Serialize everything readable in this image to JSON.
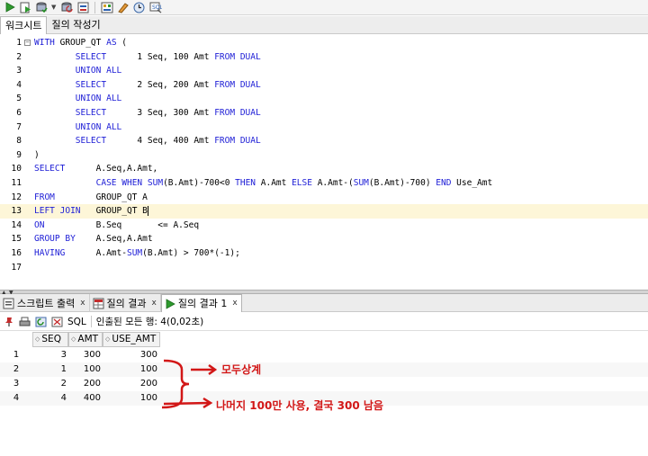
{
  "toolbar": {
    "buttons": [
      "run-statement-icon",
      "run-script-icon",
      "commit-icon",
      "rollback-icon",
      "autotrace-icon",
      "explain-plan-icon",
      "sql-tuning-icon",
      "clear-icon",
      "history-icon",
      "sql-monitor-icon"
    ]
  },
  "tabs": [
    {
      "label": "워크시트",
      "active": true
    },
    {
      "label": "질의 작성기",
      "active": false
    }
  ],
  "editor": {
    "current_line": 13,
    "lines": [
      {
        "n": "1",
        "text": "WITH GROUP_QT AS ("
      },
      {
        "n": "2",
        "text": "        SELECT      1 Seq, 100 Amt FROM DUAL"
      },
      {
        "n": "3",
        "text": "        UNION ALL"
      },
      {
        "n": "4",
        "text": "        SELECT      2 Seq, 200 Amt FROM DUAL"
      },
      {
        "n": "5",
        "text": "        UNION ALL"
      },
      {
        "n": "6",
        "text": "        SELECT      3 Seq, 300 Amt FROM DUAL"
      },
      {
        "n": "7",
        "text": "        UNION ALL"
      },
      {
        "n": "8",
        "text": "        SELECT      4 Seq, 400 Amt FROM DUAL"
      },
      {
        "n": "9",
        "text": ")"
      },
      {
        "n": "10",
        "text": "SELECT      A.Seq,A.Amt,"
      },
      {
        "n": "11",
        "text": "            CASE WHEN SUM(B.Amt)-700<0 THEN A.Amt ELSE A.Amt-(SUM(B.Amt)-700) END Use_Amt"
      },
      {
        "n": "12",
        "text": "FROM        GROUP_QT A"
      },
      {
        "n": "13",
        "text": "LEFT JOIN   GROUP_QT B"
      },
      {
        "n": "14",
        "text": "ON          B.Seq       <= A.Seq"
      },
      {
        "n": "15",
        "text": "GROUP BY    A.Seq,A.Amt"
      },
      {
        "n": "16",
        "text": "HAVING      A.Amt-SUM(B.Amt) > 700*(-1);"
      },
      {
        "n": "17",
        "text": ""
      }
    ]
  },
  "bottom_tabs": [
    {
      "label": "스크립트 출력",
      "icon": "script-output-icon",
      "close": "x",
      "active": false
    },
    {
      "label": "질의 결과",
      "icon": "query-result-icon",
      "close": "x",
      "active": false
    },
    {
      "label": "질의 결과 1",
      "icon": "run-result-icon",
      "close": "x",
      "active": true
    }
  ],
  "result_toolbar": {
    "sql_label": "SQL",
    "status": "인출된 모든 행: 4(0,02초)"
  },
  "grid": {
    "columns": [
      "SEQ",
      "AMT",
      "USE_AMT"
    ],
    "rows": [
      {
        "rownum": "1",
        "seq": "3",
        "amt": "300",
        "use_amt": "300"
      },
      {
        "rownum": "2",
        "seq": "1",
        "amt": "100",
        "use_amt": "100"
      },
      {
        "rownum": "3",
        "seq": "2",
        "amt": "200",
        "use_amt": "200"
      },
      {
        "rownum": "4",
        "seq": "4",
        "amt": "400",
        "use_amt": "100"
      }
    ]
  },
  "annotations": {
    "note1": "모두상계",
    "note2": "나머지 100만 사용, 결국 300 남음",
    "color": "#d21717"
  }
}
